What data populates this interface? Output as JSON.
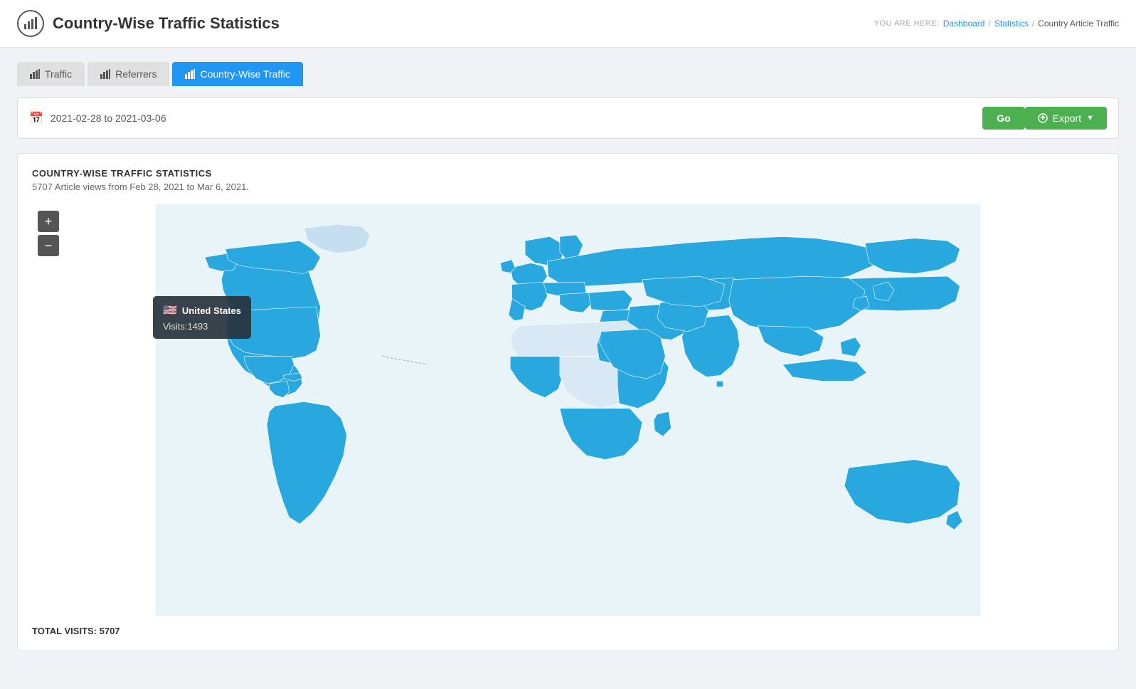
{
  "header": {
    "title": "Country-Wise Traffic Statistics",
    "logo_icon": "bar-chart-icon"
  },
  "breadcrumb": {
    "label": "YOU ARE HERE:",
    "items": [
      {
        "text": "Dashboard",
        "link": true
      },
      {
        "text": "Statistics",
        "link": true
      },
      {
        "text": "Country Article Traffic",
        "link": false
      }
    ]
  },
  "tabs": [
    {
      "id": "traffic",
      "label": "Traffic",
      "icon": "bar-chart-icon",
      "active": false
    },
    {
      "id": "referrers",
      "label": "Referrers",
      "icon": "bar-chart-icon",
      "active": false
    },
    {
      "id": "country-wise-traffic",
      "label": "Country-Wise Traffic",
      "icon": "bar-chart-icon",
      "active": true
    }
  ],
  "filter": {
    "date_range": "2021-02-28 to 2021-03-06",
    "go_label": "Go",
    "export_label": "Export"
  },
  "section": {
    "title": "COUNTRY-WISE TRAFFIC STATISTICS",
    "subtitle": "5707 Article views from Feb 28, 2021 to Mar 6, 2021."
  },
  "map": {
    "zoom_in_label": "+",
    "zoom_out_label": "−",
    "total_visits_label": "TOTAL VISITS: 5707",
    "tooltip": {
      "country": "United States",
      "flag": "🇺🇸",
      "visits_label": "Visits:",
      "visits_value": "1493"
    }
  },
  "colors": {
    "active_country": "#29a8e0",
    "inactive_country": "#d9e8f5",
    "map_bg": "#f0f6fb",
    "tab_active": "#2196f3",
    "button_green": "#4caf50"
  }
}
